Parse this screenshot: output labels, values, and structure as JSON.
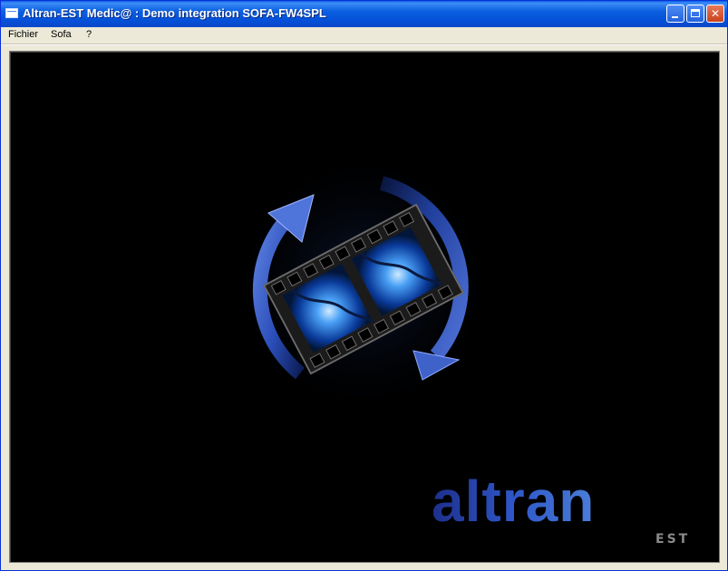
{
  "window": {
    "title": "Altran-EST Medic@ : Demo integration SOFA-FW4SPL"
  },
  "title_buttons": {
    "minimize_icon": "minimize-icon",
    "maximize_icon": "maximize-icon",
    "close_label": "✕"
  },
  "menubar": {
    "items": [
      {
        "label": "Fichier"
      },
      {
        "label": "Sofa"
      },
      {
        "label": "?"
      }
    ]
  },
  "viewport": {
    "logo": {
      "name": "altran",
      "sub": "EST"
    },
    "center_icon": "film-refresh-icon"
  },
  "colors": {
    "titlebar": "#0550d8",
    "viewport_bg": "#000000",
    "accent_blue": "#3d6fd8"
  }
}
